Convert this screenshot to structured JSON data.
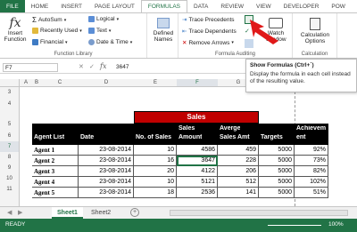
{
  "ribbon_tabs": [
    "FILE",
    "HOME",
    "INSERT",
    "PAGE LAYOUT",
    "FORMULAS",
    "DATA",
    "REVIEW",
    "VIEW",
    "DEVELOPER",
    "POW"
  ],
  "ribbon": {
    "insert_function": "Insert Function",
    "autosum": "AutoSum",
    "recently_used": "Recently Used",
    "financial": "Financial",
    "logical": "Logical",
    "text": "Text",
    "date_time": "Date & Time",
    "function_library_label": "Function Library",
    "defined_names": "Defined Names",
    "trace_precedents": "Trace Precedents",
    "trace_dependents": "Trace Dependents",
    "remove_arrows": "Remove Arrows",
    "formula_auditing_label": "Formula Auditing",
    "watch_window": "Watch Window",
    "calculation_options": "Calculation Options",
    "calculation_label": "Calculation"
  },
  "formula_bar": {
    "name_box": "F7",
    "value": "3647"
  },
  "tooltip": {
    "title": "Show Formulas (Ctrl+`)",
    "description": "Display the formula in each cell instead of the resulting value."
  },
  "columns": [
    "A",
    "B",
    "C",
    "D",
    "E",
    "F",
    "G",
    "H",
    "I"
  ],
  "rows": [
    "3",
    "4",
    "5",
    "6",
    "7",
    "8",
    "9",
    "10",
    "11"
  ],
  "table": {
    "title": "Sales",
    "headers": [
      "Agent List",
      "Date",
      "No. of Sales",
      "Sales Amount",
      "Averge Sales Amt",
      "Targets",
      "Achievement"
    ],
    "header_top": [
      "",
      "",
      "",
      "Sales",
      "Averge",
      "",
      "Achievem"
    ],
    "header_bottom": [
      "Agent List",
      "Date",
      "No. of Sales",
      "Amount",
      "Sales Amt",
      "Targets",
      "ent"
    ],
    "rows": [
      [
        "Agent 1",
        "23-08-2014",
        "10",
        "4586",
        "459",
        "5000",
        "92%"
      ],
      [
        "Agent 2",
        "23-08-2014",
        "16",
        "3647",
        "228",
        "5000",
        "73%"
      ],
      [
        "Agent 3",
        "23-08-2014",
        "20",
        "4122",
        "206",
        "5000",
        "82%"
      ],
      [
        "Agent 4",
        "23-08-2014",
        "10",
        "5121",
        "512",
        "5000",
        "102%"
      ],
      [
        "Agent 5",
        "23-08-2014",
        "18",
        "2536",
        "141",
        "5000",
        "51%"
      ]
    ]
  },
  "sheet_tabs": [
    "Sheet1",
    "Sheet2"
  ],
  "status": {
    "ready": "READY",
    "zoom": "100%"
  },
  "colors": {
    "excel_green": "#217346",
    "title_red": "#c00000",
    "table_black": "#000000"
  }
}
